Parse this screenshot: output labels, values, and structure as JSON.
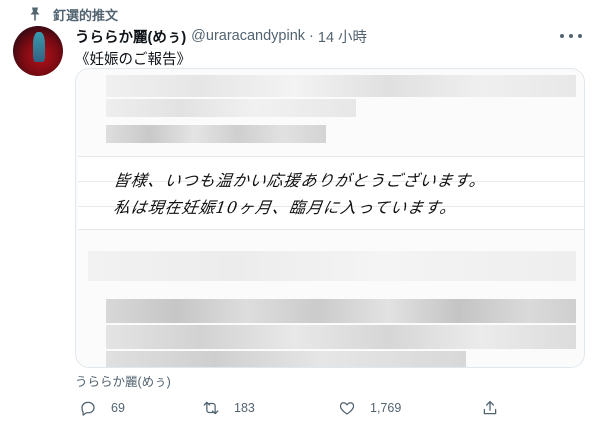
{
  "pinned": {
    "label": "釘選的推文",
    "icon": "pin-icon"
  },
  "tweet": {
    "display_name": "うららか麗(めぅ)",
    "handle": "@uraracandypink",
    "separator": "·",
    "time": "14 小時",
    "text": "《妊娠のご報告》",
    "media": {
      "handwritten_lines": [
        "皆様、いつも温かい応援ありがとうございます。",
        "私は現在妊娠10ヶ月、臨月に入っています。"
      ]
    },
    "photo_caption": "うららか麗(めぅ)"
  },
  "actions": {
    "reply": {
      "icon": "reply-icon",
      "count": "69"
    },
    "retweet": {
      "icon": "retweet-icon",
      "count": "183"
    },
    "like": {
      "icon": "heart-icon",
      "count": "1,769"
    },
    "share": {
      "icon": "share-icon"
    }
  },
  "colors": {
    "text": "#0f1419",
    "secondary": "#536471",
    "border": "#e1e8ed"
  }
}
